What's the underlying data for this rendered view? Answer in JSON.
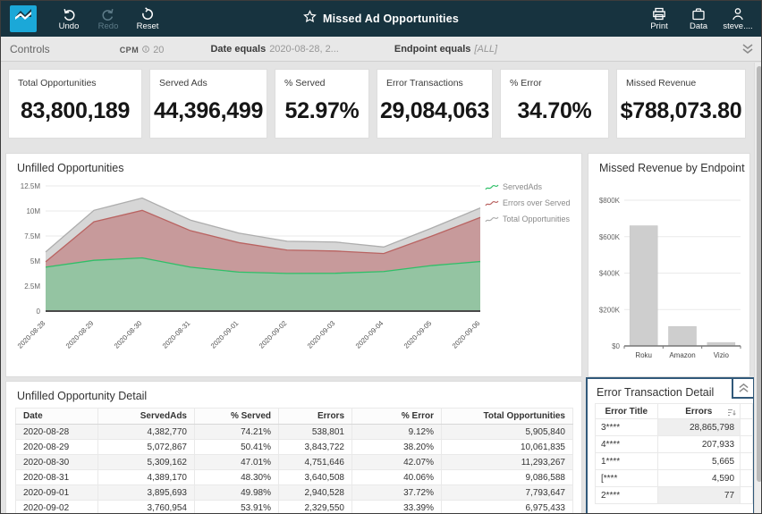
{
  "topbar": {
    "title": "Missed Ad Opportunities",
    "toolbar": [
      {
        "id": "undo",
        "label": "Undo",
        "enabled": true
      },
      {
        "id": "redo",
        "label": "Redo",
        "enabled": false
      },
      {
        "id": "reset",
        "label": "Reset",
        "enabled": true
      }
    ],
    "actions": [
      {
        "id": "print",
        "label": "Print"
      },
      {
        "id": "data",
        "label": "Data"
      },
      {
        "id": "user",
        "label": "steve...."
      }
    ]
  },
  "controls_bar": {
    "label": "Controls",
    "filters": [
      {
        "name": "CPM",
        "value": "20"
      },
      {
        "name": "Date equals",
        "value": "2020-08-28, 2..."
      },
      {
        "name": "Endpoint equals",
        "value": "[ALL]"
      }
    ]
  },
  "kpis": [
    {
      "label": "Total Opportunities",
      "value": "83,800,189"
    },
    {
      "label": "Served Ads",
      "value": "44,396,499"
    },
    {
      "label": "% Served",
      "value": "52.97%"
    },
    {
      "label": "Error Transactions",
      "value": "29,084,063"
    },
    {
      "label": "% Error",
      "value": "34.70%"
    },
    {
      "label": "Missed Revenue",
      "value": "$788,073.80"
    }
  ],
  "chart_data": [
    {
      "id": "unfilled-opportunities",
      "type": "area",
      "title": "Unfilled Opportunities",
      "x": [
        "2020-08-28",
        "2020-08-29",
        "2020-08-30",
        "2020-08-31",
        "2020-09-01",
        "2020-09-02",
        "2020-09-03",
        "2020-09-04",
        "2020-09-05",
        "2020-09-06"
      ],
      "series": [
        {
          "name": "ServedAds",
          "color": "#2fbf68",
          "fill": "#94c4a2",
          "values": [
            4382770,
            5072867,
            5309162,
            4389170,
            3895693,
            3760954,
            3780000,
            3950000,
            4550000,
            4950000
          ]
        },
        {
          "name": "Errors over Served",
          "color": "#b96361",
          "fill": "#c79a9b",
          "values": [
            4921571,
            8916589,
            10060808,
            8029678,
            6836221,
            6090504,
            6000000,
            5750000,
            7500000,
            9350000
          ]
        },
        {
          "name": "Total Opportunities",
          "color": "#adadad",
          "fill": "#d6d6d6",
          "values": [
            5905840,
            10061835,
            11293267,
            9086588,
            7793647,
            6975433,
            6900000,
            6400000,
            8300000,
            10300000
          ]
        }
      ],
      "ylim": [
        0,
        12500000
      ],
      "yticks": [
        "12.5M",
        "10M",
        "7.5M",
        "5M",
        "2.5M",
        "0"
      ],
      "legend_position": "right",
      "grid": true
    },
    {
      "id": "missed-revenue-by-endpoint",
      "type": "bar",
      "title": "Missed Revenue by Endpoint",
      "categories": [
        "Roku",
        "Amazon",
        "Vizio"
      ],
      "values": [
        660000,
        107000,
        19000
      ],
      "ylim": [
        0,
        800000
      ],
      "yticks": [
        "$800K",
        "$600K",
        "$400K",
        "$200K",
        "$0"
      ],
      "bar_color": "#cecece",
      "grid": true
    }
  ],
  "detail_table": {
    "title": "Unfilled Opportunity Detail",
    "columns": [
      "Date",
      "ServedAds",
      "% Served",
      "Errors",
      "% Error",
      "Total Opportunities"
    ],
    "rows": [
      [
        "2020-08-28",
        "4,382,770",
        "74.21%",
        "538,801",
        "9.12%",
        "5,905,840"
      ],
      [
        "2020-08-29",
        "5,072,867",
        "50.41%",
        "3,843,722",
        "38.20%",
        "10,061,835"
      ],
      [
        "2020-08-30",
        "5,309,162",
        "47.01%",
        "4,751,646",
        "42.07%",
        "11,293,267"
      ],
      [
        "2020-08-31",
        "4,389,170",
        "48.30%",
        "3,640,508",
        "40.06%",
        "9,086,588"
      ],
      [
        "2020-09-01",
        "3,895,693",
        "49.98%",
        "2,940,528",
        "37.72%",
        "7,793,647"
      ],
      [
        "2020-09-02",
        "3,760,954",
        "53.91%",
        "2,329,550",
        "33.39%",
        "6,975,433"
      ]
    ]
  },
  "error_table": {
    "title": "Error Transaction Detail",
    "columns": [
      "Error Title",
      "Errors"
    ],
    "rows": [
      [
        "3****",
        "28,865,798"
      ],
      [
        "4****",
        "207,933"
      ],
      [
        "1****",
        "5,665"
      ],
      [
        "[****",
        "4,590"
      ],
      [
        "2****",
        "77"
      ]
    ]
  },
  "colors": {
    "topbar": "#17333f",
    "logo": "#1ba8d8",
    "selection_border": "#31597a",
    "controls_bar": "#e8e8e8",
    "background": "#e4e4e4"
  }
}
